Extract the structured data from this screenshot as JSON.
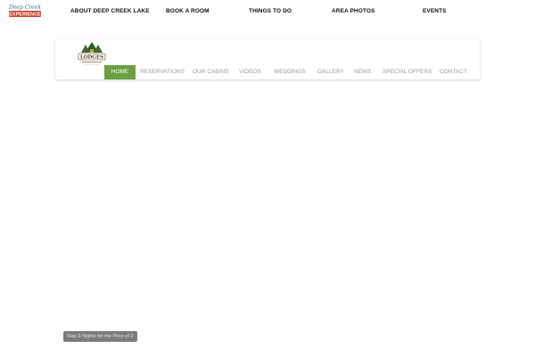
{
  "brand": {
    "logo_line1": "Deep Creek",
    "logo_line2": "EXPERIENCE"
  },
  "top_nav": [
    {
      "label": "ABOUT DEEP CREEK LAKE"
    },
    {
      "label": "BOOK A ROOM"
    },
    {
      "label": "THINGS TO DO"
    },
    {
      "label": "AREA PHOTOS"
    },
    {
      "label": "EVENTS"
    }
  ],
  "lodge": {
    "logo_text": "LODGES"
  },
  "main_nav": [
    {
      "label": "HOME",
      "active": true
    },
    {
      "label": "RESERVATIONS"
    },
    {
      "label": "OUR CABINS"
    },
    {
      "label": "VIDEOS"
    },
    {
      "label": "WEDDINGS"
    },
    {
      "label": "GALLERY"
    },
    {
      "label": "NEWS"
    },
    {
      "label": "SPECIAL OFFERS"
    },
    {
      "label": "CONTACT"
    }
  ],
  "promo": {
    "label": "Stay 3 Nights for the Price of 2"
  },
  "colors": {
    "nav_active": "#6aa03f",
    "nav_text": "#9b9b9b",
    "promo_bg": "#7b7b7b"
  }
}
